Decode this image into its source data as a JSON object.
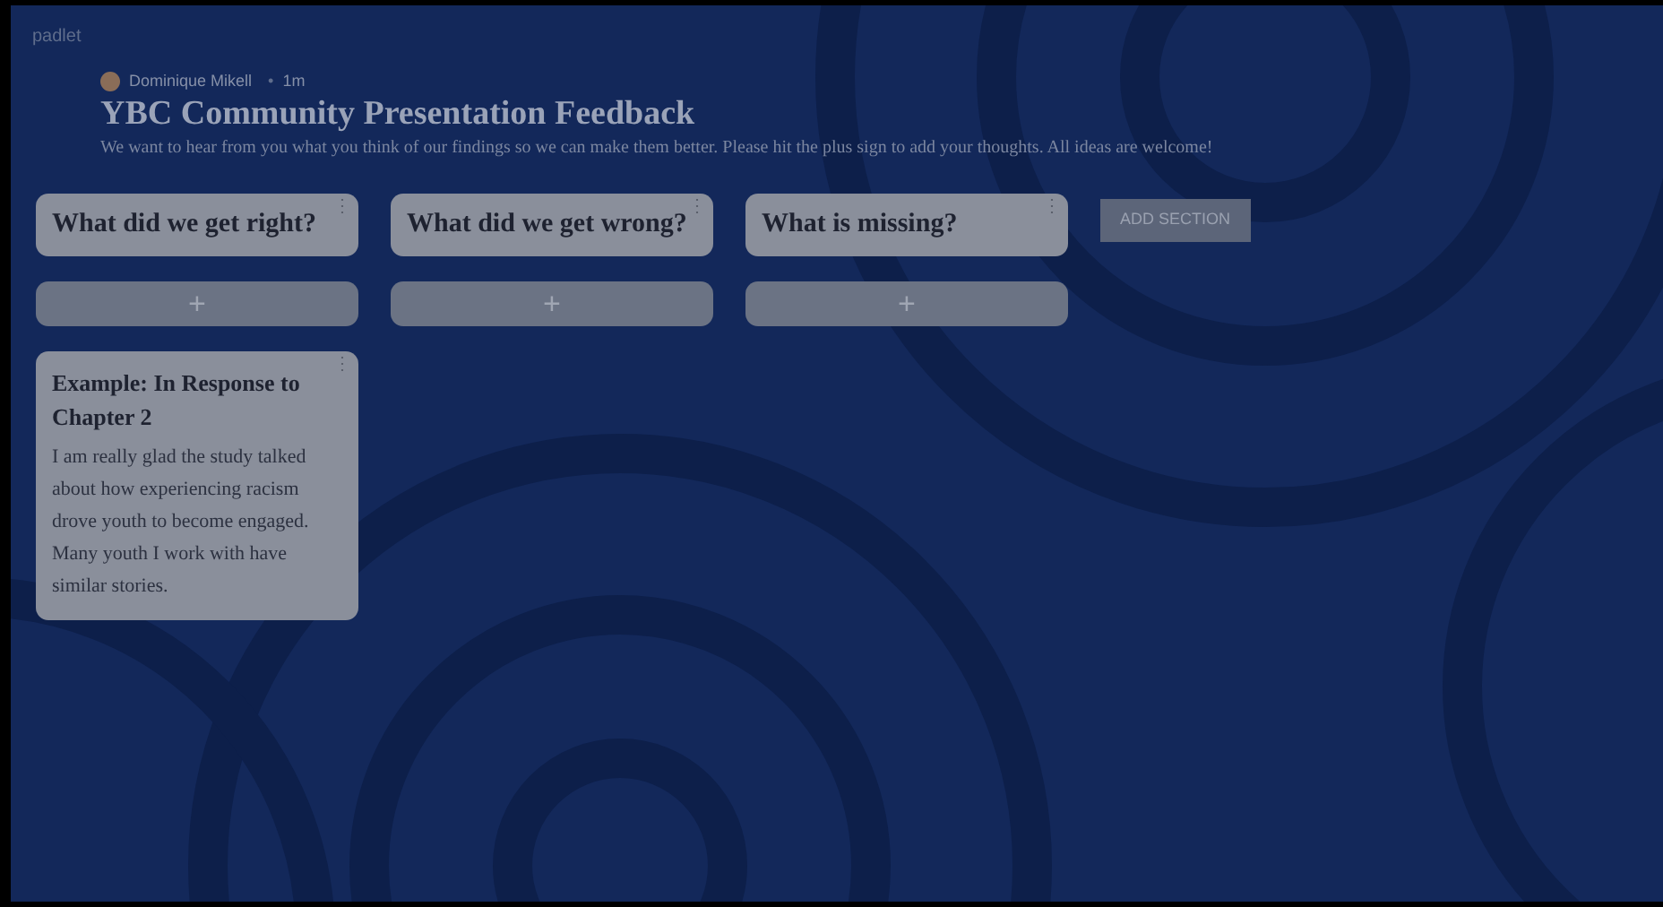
{
  "app": {
    "logo": "padlet"
  },
  "header": {
    "author": "Dominique Mikell",
    "separator": "•",
    "time": "1m",
    "title": "YBC Community Presentation Feedback",
    "description": "We want to hear from you what you think of our findings so we can make them better. Please hit the plus sign to add your thoughts. All ideas are welcome!"
  },
  "sections": [
    {
      "title": "What did we get right?",
      "menu": "⋮",
      "add": "+",
      "posts": [
        {
          "title": "Example: In Response to Chapter 2",
          "menu": "⋮",
          "body": "I am really glad the study talked about how experiencing racism drove youth to become engaged. Many youth I work with have similar stories."
        }
      ]
    },
    {
      "title": "What did we get wrong?",
      "menu": "⋮",
      "add": "+"
    },
    {
      "title": "What is missing?",
      "menu": "⋮",
      "add": "+"
    }
  ],
  "add_section": "ADD SECTION"
}
